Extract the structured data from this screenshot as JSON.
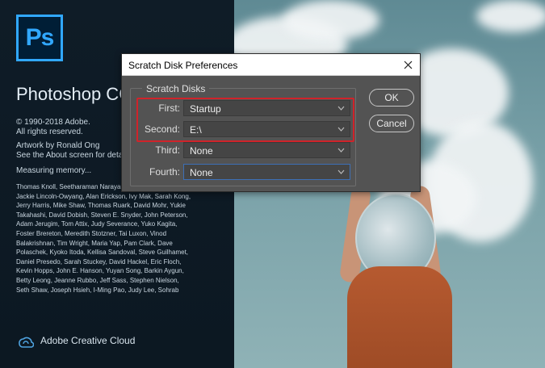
{
  "splash": {
    "logo_text": "Ps",
    "product_name": "Photoshop CC",
    "copyright": [
      "© 1990-2018 Adobe.",
      "All rights reserved."
    ],
    "artwork": [
      "Artwork by Ronald Ong",
      "See the About screen for details"
    ],
    "status": "Measuring memory...",
    "credits": [
      "Thomas Knoll, Seetharaman Narayanan,",
      "Jackie Lincoln-Owyang, Alan Erickson, Ivy Mak, Sarah Kong,",
      "Jerry Harris, Mike Shaw, Thomas Ruark, David Mohr, Yukie",
      "Takahashi, David Dobish, Steven E. Snyder, John Peterson,",
      "Adam Jerugim, Tom Attix, Judy Severance, Yuko Kagita,",
      "Foster Brereton, Meredith Stotzner, Tai Luxon, Vinod",
      "Balakrishnan, Tim Wright, Maria Yap, Pam Clark, Dave",
      "Polaschek, Kyoko Itoda, Kellisa Sandoval, Steve Guilhamet,",
      "Daniel Presedo, Sarah Stuckey, David Hackel, Eric Floch,",
      "Kevin Hopps, John E. Hanson, Yuyan Song, Barkin Aygun,",
      "Betty Leong, Jeanne Rubbo, Jeff Sass, Stephen Nielson,",
      "Seth Shaw, Joseph Hsieh, I-Ming Pao, Judy Lee, Sohrab"
    ],
    "cc_label": "Adobe Creative Cloud"
  },
  "dialog": {
    "title": "Scratch Disk Preferences",
    "group_label": "Scratch Disks",
    "rows": [
      {
        "label": "First:",
        "value": "Startup"
      },
      {
        "label": "Second:",
        "value": "E:\\"
      },
      {
        "label": "Third:",
        "value": "None"
      },
      {
        "label": "Fourth:",
        "value": "None"
      }
    ],
    "ok_label": "OK",
    "cancel_label": "Cancel"
  },
  "colors": {
    "ps_blue": "#31a8ff",
    "dialog_bg": "#535353",
    "highlight_red": "#d0232a",
    "focus_blue": "#3d6fb6"
  },
  "icons": [
    "photoshop-logo",
    "close-icon",
    "chevron-down-icon",
    "creative-cloud-icon"
  ]
}
